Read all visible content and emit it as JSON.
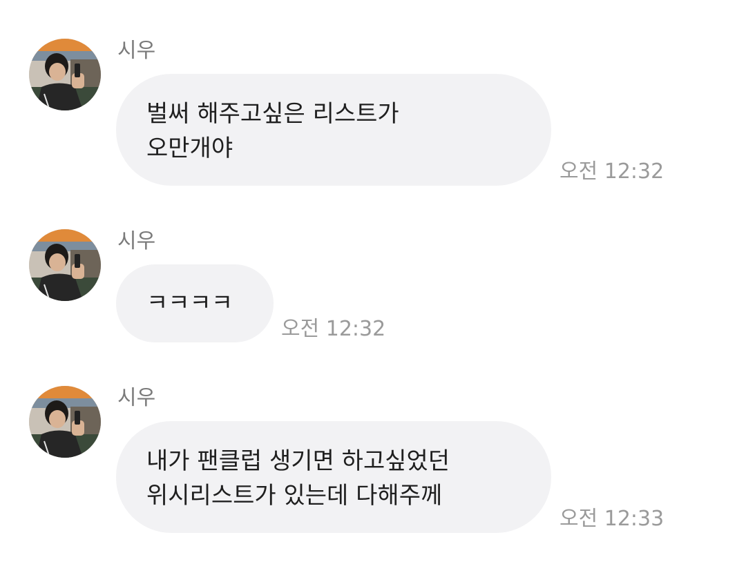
{
  "messages": [
    {
      "sender": "시우",
      "lines": [
        "벌써 해주고싶은 리스트가",
        "오만개야"
      ],
      "time": "오전 12:32"
    },
    {
      "sender": "시우",
      "lines": [
        "ㅋㅋㅋㅋ"
      ],
      "time": "오전 12:32"
    },
    {
      "sender": "시우",
      "lines": [
        "내가 팬클럽 생기면 하고싶었던",
        "위시리스트가 있는데 다해주께"
      ],
      "time": "오전 12:33"
    }
  ],
  "colors": {
    "bubble": "#f2f2f4",
    "sender": "#7a7a7a",
    "time": "#9a9a9a",
    "text": "#1f1f1f"
  },
  "icons": {
    "avatar": "profile-photo-avatar"
  }
}
